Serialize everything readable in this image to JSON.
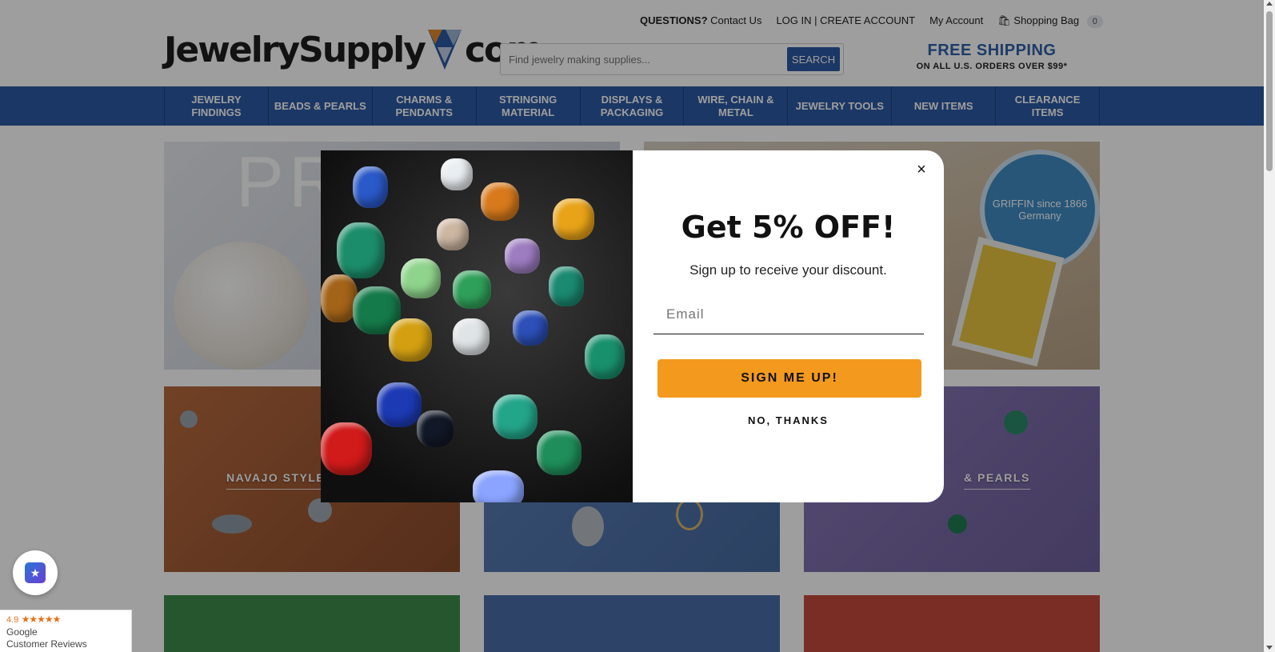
{
  "header": {
    "logo_left": "JewelrySupply",
    "logo_right": "com",
    "questions_label": "QUESTIONS?",
    "contact_link": "Contact Us",
    "login_link": "LOG IN | CREATE ACCOUNT",
    "account_link": "My Account",
    "bag_link": "Shopping Bag",
    "bag_count": "0",
    "search_placeholder": "Find jewelry making supplies...",
    "search_button": "SEARCH",
    "shipping_title": "FREE SHIPPING",
    "shipping_sub": "ON ALL U.S. ORDERS OVER $99*"
  },
  "nav": {
    "items": [
      {
        "label": "JEWELRY FINDINGS"
      },
      {
        "label": "BEADS & PEARLS"
      },
      {
        "label": "CHARMS & PENDANTS"
      },
      {
        "label": "STRINGING MATERIAL"
      },
      {
        "label": "DISPLAYS & PACKAGING"
      },
      {
        "label": "WIRE, CHAIN & METAL"
      },
      {
        "label": "JEWELRY TOOLS"
      },
      {
        "label": "NEW ITEMS"
      },
      {
        "label": "CLEARANCE ITEMS"
      }
    ]
  },
  "tiles": {
    "t1_text": "PR",
    "griffin_text": "GRIFFIN since 1866 Germany",
    "t3_label": "NAVAJO STYLE B",
    "t5_label": "& PEARLS"
  },
  "modal": {
    "title": "Get 5% OFF!",
    "subtitle": "Sign up to receive your discount.",
    "email_placeholder": "Email",
    "submit_label": "SIGN ME UP!",
    "decline_label": "NO, THANKS",
    "close_label": "×"
  },
  "widgets": {
    "google_rating": "4.9",
    "google_stars": "★★★★★",
    "google_line1": "Google",
    "google_line2": "Customer Reviews"
  },
  "colors": {
    "nav_blue": "#2d5aa3",
    "shipping_blue": "#2f5fa6",
    "cta_orange": "#f39a1e"
  }
}
